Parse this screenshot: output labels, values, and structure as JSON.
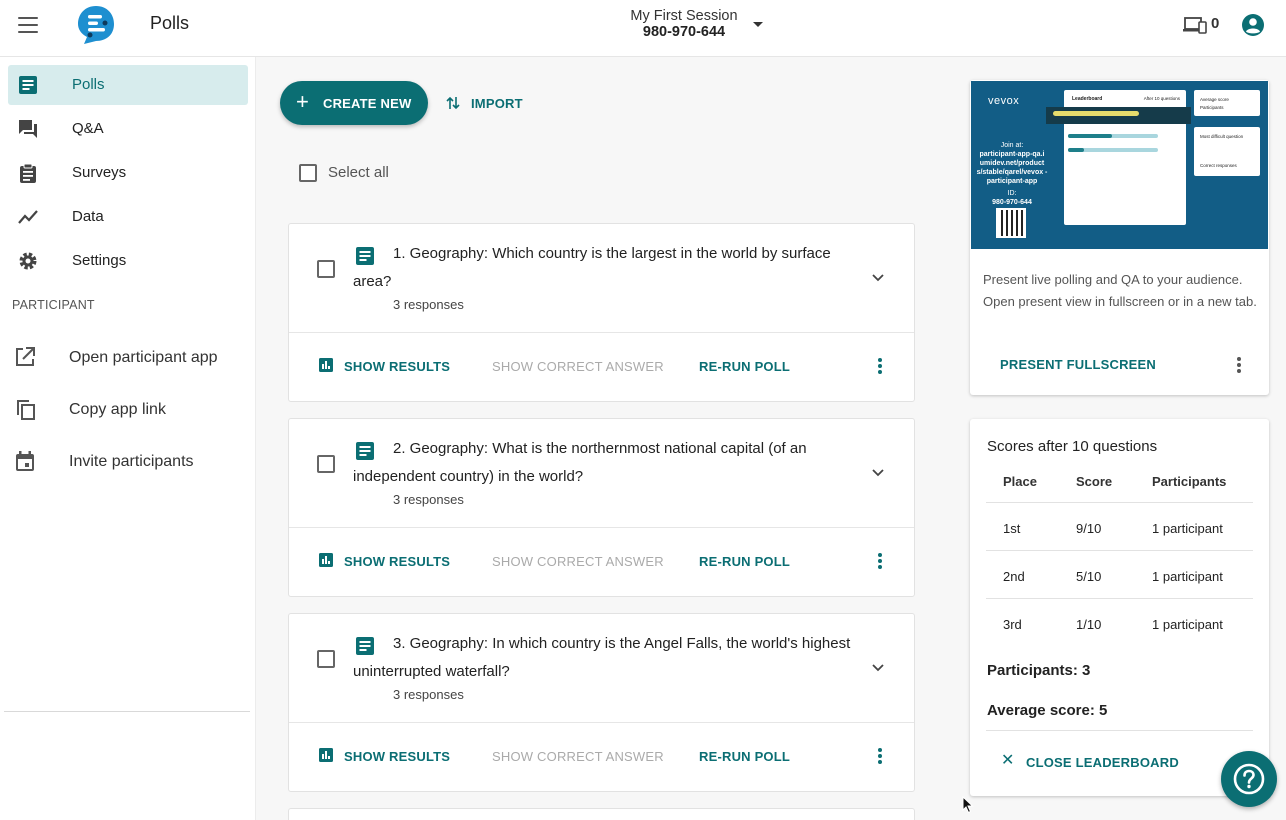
{
  "header": {
    "app_title": "Polls",
    "session_name": "My First Session",
    "session_id": "980-970-644",
    "connected_devices": "0"
  },
  "sidebar": {
    "items": [
      {
        "label": "Polls",
        "icon": "polls-icon",
        "active": true
      },
      {
        "label": "Q&A",
        "icon": "qa-icon"
      },
      {
        "label": "Surveys",
        "icon": "surveys-icon"
      },
      {
        "label": "Data",
        "icon": "data-icon"
      },
      {
        "label": "Settings",
        "icon": "gear-icon"
      }
    ],
    "section_label": "PARTICIPANT",
    "participant_items": [
      {
        "label": "Open participant app",
        "icon": "open-external-icon"
      },
      {
        "label": "Copy app link",
        "icon": "copy-icon"
      },
      {
        "label": "Invite participants",
        "icon": "calendar-icon"
      }
    ]
  },
  "toolbar": {
    "create_label": "CREATE NEW",
    "import_label": "IMPORT",
    "select_all_label": "Select all"
  },
  "polls": [
    {
      "question": "1. Geography: Which country is the largest in the world by surface area?",
      "responses": "3 responses"
    },
    {
      "question": "2. Geography: What is the northernmost national capital (of an independent country) in the world?",
      "responses": "3 responses"
    },
    {
      "question": "3. Geography: In which country is the Angel Falls, the world's highest uninterrupted waterfall?",
      "responses": "3 responses"
    }
  ],
  "poll_actions": {
    "show_results": "SHOW RESULTS",
    "show_correct_answer": "SHOW CORRECT ANSWER",
    "rerun": "RE-RUN POLL"
  },
  "present": {
    "preview_brand": "vevox",
    "preview_join_label": "Join at:",
    "preview_join_url": "participant-app-qa.i umidev.net/product s/stable/qarel/vevox -participant-app",
    "preview_id_label": "ID:",
    "preview_id": "980-970-644",
    "preview_leaderboard_title": "Leaderboard",
    "preview_leaderboard_sub": "After 10 questions",
    "preview_avg_label": "Average score",
    "preview_participants_label": "Participants",
    "preview_difficult_label": "Most difficult question",
    "preview_correct_label": "Correct responses",
    "description": "Present live polling and QA to your audience. Open present view in fullscreen or in a new tab.",
    "button_label": "PRESENT FULLSCREEN"
  },
  "leaderboard": {
    "title": "Scores after 10 questions",
    "columns": [
      "Place",
      "Score",
      "Participants"
    ],
    "rows": [
      [
        "1st",
        "9/10",
        "1 participant"
      ],
      [
        "2nd",
        "5/10",
        "1 participant"
      ],
      [
        "3rd",
        "1/10",
        "1 participant"
      ]
    ],
    "participants_label": "Participants: 3",
    "average_label": "Average score: 5",
    "close_label": "CLOSE LEADERBOARD"
  },
  "colors": {
    "accent": "#0b6e73",
    "accent_light": "#d7eced",
    "preview_bg": "#125d86"
  }
}
